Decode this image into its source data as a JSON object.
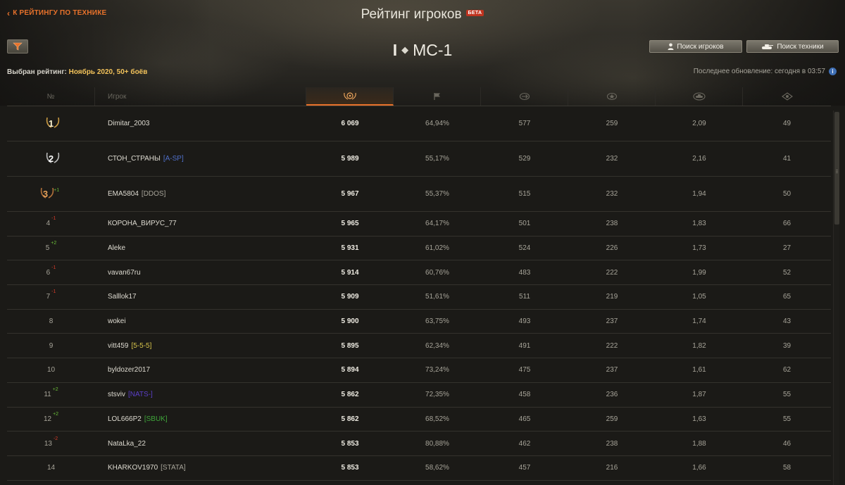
{
  "header": {
    "back_link": "К РЕЙТИНГУ ПО ТЕХНИКЕ",
    "title": "Рейтинг игроков",
    "beta_badge": "БЕТА",
    "tank_tier": "I",
    "tank_name": "МС-1",
    "search_players": "Поиск игроков",
    "search_vehicles": "Поиск техники",
    "selected_label": "Выбран рейтинг:",
    "selected_value": "Ноябрь 2020, 50+ боёв",
    "last_update": "Последнее обновление: сегодня в 03:57",
    "info_icon_char": "i"
  },
  "columns": {
    "no": "№",
    "player": "Игрок"
  },
  "colors": {
    "accent": "#e8722b",
    "clan_blue": "#4f6fc9",
    "clan_gold": "#d6c34a",
    "clan_purple": "#5b3fc9",
    "clan_green": "#3fa63a",
    "delta_up": "#6cbf3a",
    "delta_down": "#d23a2a"
  },
  "rows": [
    {
      "rank": "1",
      "delta": "",
      "name": "Dimitar_2003",
      "clan": "",
      "rating": "6 069",
      "win": "64,94%",
      "damage": "577",
      "xp": "259",
      "kills": "2,09",
      "spot": "49"
    },
    {
      "rank": "2",
      "delta": "",
      "name": "СТОН_СТРАНЫ",
      "clan": "[A-SP]",
      "rating": "5 989",
      "win": "55,17%",
      "damage": "529",
      "xp": "232",
      "kills": "2,16",
      "spot": "41"
    },
    {
      "rank": "3",
      "delta": "+1",
      "name": "EMA5804",
      "clan": "[DDOS]",
      "rating": "5 967",
      "win": "55,37%",
      "damage": "515",
      "xp": "232",
      "kills": "1,94",
      "spot": "50"
    },
    {
      "rank": "4",
      "delta": "-1",
      "name": "КОРОНА_ВИРУС_77",
      "clan": "",
      "rating": "5 965",
      "win": "64,17%",
      "damage": "501",
      "xp": "238",
      "kills": "1,83",
      "spot": "66"
    },
    {
      "rank": "5",
      "delta": "+2",
      "name": "Aleke",
      "clan": "",
      "rating": "5 931",
      "win": "61,02%",
      "damage": "524",
      "xp": "226",
      "kills": "1,73",
      "spot": "27"
    },
    {
      "rank": "6",
      "delta": "-1",
      "name": "vavan67ru",
      "clan": "",
      "rating": "5 914",
      "win": "60,76%",
      "damage": "483",
      "xp": "222",
      "kills": "1,99",
      "spot": "52"
    },
    {
      "rank": "7",
      "delta": "-1",
      "name": "Salllok17",
      "clan": "",
      "rating": "5 909",
      "win": "51,61%",
      "damage": "511",
      "xp": "219",
      "kills": "1,05",
      "spot": "65"
    },
    {
      "rank": "8",
      "delta": "",
      "name": "wokei",
      "clan": "",
      "rating": "5 900",
      "win": "63,75%",
      "damage": "493",
      "xp": "237",
      "kills": "1,74",
      "spot": "43"
    },
    {
      "rank": "9",
      "delta": "",
      "name": "vitt459",
      "clan": "[5-5-5]",
      "rating": "5 895",
      "win": "62,34%",
      "damage": "491",
      "xp": "222",
      "kills": "1,82",
      "spot": "39"
    },
    {
      "rank": "10",
      "delta": "",
      "name": "byldozer2017",
      "clan": "",
      "rating": "5 894",
      "win": "73,24%",
      "damage": "475",
      "xp": "237",
      "kills": "1,61",
      "spot": "62"
    },
    {
      "rank": "11",
      "delta": "+2",
      "name": "stsviv",
      "clan": "[NATS-]",
      "rating": "5 862",
      "win": "72,35%",
      "damage": "458",
      "xp": "236",
      "kills": "1,87",
      "spot": "55"
    },
    {
      "rank": "12",
      "delta": "+2",
      "name": "LOL666P2",
      "clan": "[SBUK]",
      "rating": "5 862",
      "win": "68,52%",
      "damage": "465",
      "xp": "259",
      "kills": "1,63",
      "spot": "55"
    },
    {
      "rank": "13",
      "delta": "-2",
      "name": "NataLka_22",
      "clan": "",
      "rating": "5 853",
      "win": "80,88%",
      "damage": "462",
      "xp": "238",
      "kills": "1,88",
      "spot": "46"
    },
    {
      "rank": "14",
      "delta": "",
      "name": "KHARKOV1970",
      "clan": "[STATA]",
      "rating": "5 853",
      "win": "58,62%",
      "damage": "457",
      "xp": "216",
      "kills": "1,66",
      "spot": "58"
    }
  ]
}
